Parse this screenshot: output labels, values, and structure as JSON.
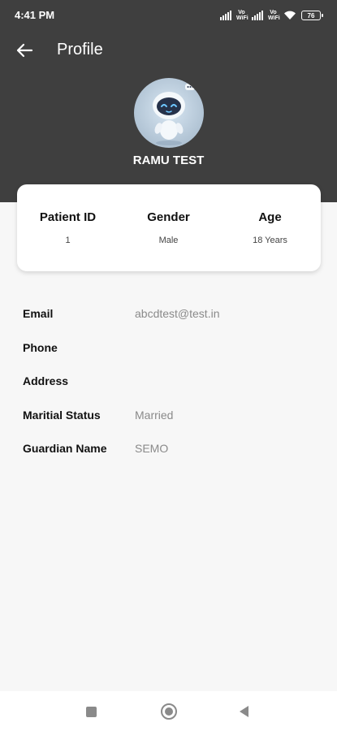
{
  "status_bar": {
    "time": "4:41 PM",
    "volte1": "Vo\nWiFi",
    "volte2": "Vo\nWiFi",
    "battery": "76"
  },
  "header": {
    "title": "Profile",
    "back_icon": "arrow-left-icon",
    "user_name": "RAMU TEST",
    "background_color": "#3f3f3f"
  },
  "summary": {
    "patient_id_label": "Patient ID",
    "patient_id_value": "1",
    "gender_label": "Gender",
    "gender_value": "Male",
    "age_label": "Age",
    "age_value": "18 Years"
  },
  "details": [
    {
      "label": "Email",
      "value": "abcdtest@test.in"
    },
    {
      "label": "Phone",
      "value": ""
    },
    {
      "label": "Address",
      "value": ""
    },
    {
      "label": "Maritial Status",
      "value": "Married"
    },
    {
      "label": "Guardian Name",
      "value": "SEMO"
    }
  ],
  "nav_bar": {
    "recents_icon": "square-icon",
    "home_icon": "circle-icon",
    "back_icon": "triangle-back-icon"
  }
}
